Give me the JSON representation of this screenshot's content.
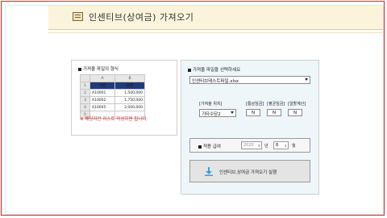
{
  "header": {
    "title": "인센티브(상여금) 가져오기",
    "icon": "document-icon"
  },
  "left_panel": {
    "title": "가져올 파일의 형식",
    "sheet": {
      "col_headers": [
        "A",
        "B"
      ],
      "row_numbers": [
        "1",
        "2",
        "3",
        "4",
        "5"
      ],
      "header_cells": [
        "사번",
        "금액"
      ],
      "rows": [
        [
          "A10001",
          "1,500,000"
        ],
        [
          "A10002",
          "1,750,000"
        ],
        [
          "A10005",
          "2,000,000"
        ]
      ],
      "header_color": "#1f3b7a"
    },
    "warning": "※ 해당자만 리스트 작성하면 됩니다.",
    "warning_color": "#d02020"
  },
  "right_panel": {
    "file_title": "가져올 파일을 선택하세요",
    "file_select_value": "인센티브테스트파일.xlsx",
    "labels": {
      "target": "[가져올 위치]",
      "ordinary": "[통상임금]",
      "average": "[평균임금]",
      "tax": "[일할계산]"
    },
    "target_value": "기타수당2",
    "ordinary_value": "N",
    "average_value": "N",
    "tax_value": "N",
    "date_label": "적용 급여",
    "year_value": "2020",
    "year_unit": "년",
    "month_value": "8",
    "month_unit": "월",
    "run_button_label": "인센티브,상여금 가져오기 실행",
    "run_icon": "download-icon"
  }
}
